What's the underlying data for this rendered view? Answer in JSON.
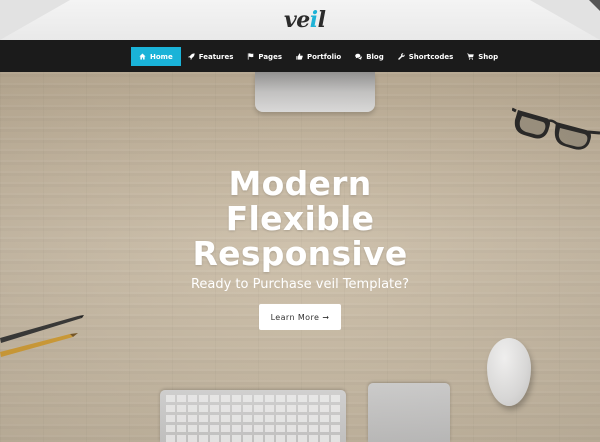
{
  "logo": {
    "text_main": "ve",
    "text_accent": "i",
    "text_end": "l"
  },
  "nav": {
    "items": [
      {
        "label": "Home",
        "icon": "home-icon",
        "active": true
      },
      {
        "label": "Features",
        "icon": "rocket-icon",
        "active": false
      },
      {
        "label": "Pages",
        "icon": "flag-icon",
        "active": false
      },
      {
        "label": "Portfolio",
        "icon": "thumbs-up-icon",
        "active": false
      },
      {
        "label": "Blog",
        "icon": "comments-icon",
        "active": false
      },
      {
        "label": "Shortcodes",
        "icon": "wrench-icon",
        "active": false
      },
      {
        "label": "Shop",
        "icon": "cart-icon",
        "active": false
      }
    ]
  },
  "hero": {
    "headline": [
      "Modern",
      "Flexible",
      "Responsive"
    ],
    "subline": "Ready to Purchase veil Template?",
    "cta_label": "Learn More",
    "cta_icon": "arrow-right-icon"
  },
  "colors": {
    "accent": "#1ab3d8",
    "navbar": "#1b1b1b",
    "header": "#eeeeee"
  }
}
